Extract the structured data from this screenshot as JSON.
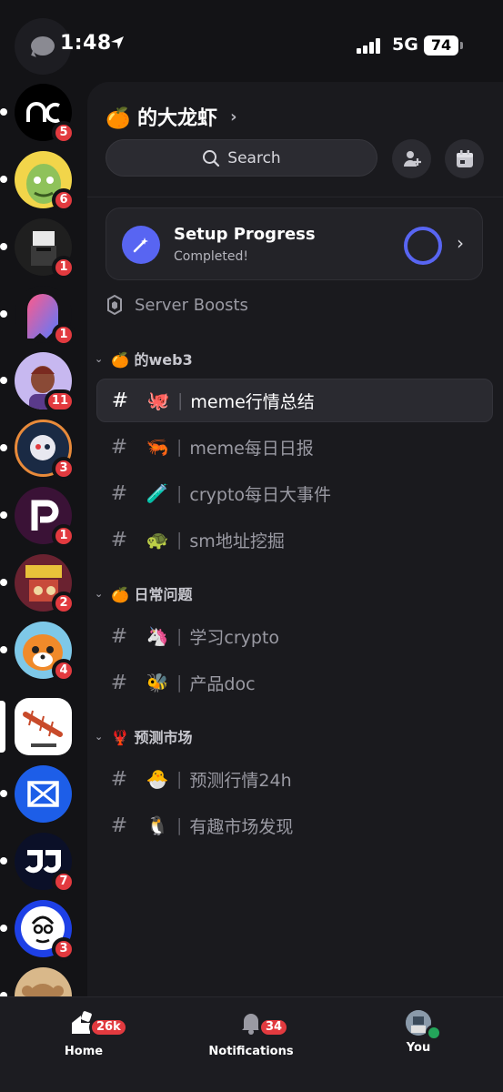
{
  "status": {
    "time": "1:48",
    "network": "5G",
    "battery": "74"
  },
  "rail": {
    "servers": [
      {
        "name": "server-ac",
        "badge": "5",
        "color": "#000000"
      },
      {
        "name": "server-ape",
        "badge": "6",
        "color": "#f2d54a"
      },
      {
        "name": "server-character",
        "badge": "1",
        "color": "#2a2a2a"
      },
      {
        "name": "server-ghost",
        "badge": "1",
        "color": "#131316"
      },
      {
        "name": "server-avatar",
        "badge": "11",
        "color": "#c7b8f0"
      },
      {
        "name": "server-robot",
        "badge": "3",
        "color": "#1a2a44"
      },
      {
        "name": "server-p",
        "badge": "1",
        "color": "#3a1236"
      },
      {
        "name": "server-art",
        "badge": "2",
        "color": "#6a2230"
      },
      {
        "name": "server-tiger",
        "badge": "4",
        "color": "#7ec8e8"
      },
      {
        "name": "server-lobster",
        "badge": "",
        "color": "#ffffff",
        "active": true
      },
      {
        "name": "server-blue",
        "badge": "",
        "color": "#1d5ee8"
      },
      {
        "name": "server-jj",
        "badge": "7",
        "color": "#0b1028"
      },
      {
        "name": "server-sketch",
        "badge": "3",
        "color": "#1e40e6"
      },
      {
        "name": "server-monkey",
        "badge": "",
        "color": "#d9b88a"
      }
    ]
  },
  "server": {
    "title": "🍊 的大龙虾",
    "search_label": "Search",
    "setup_title": "Setup Progress",
    "setup_status": "Completed!",
    "boosts_label": "Server Boosts"
  },
  "categories": [
    {
      "label": "🍊 的web3"
    },
    {
      "label": "🍊 日常问题"
    },
    {
      "label": "🦞 预测市场"
    }
  ],
  "channels": [
    {
      "emoji": "🐙",
      "name": "meme行情总结",
      "selected": true
    },
    {
      "emoji": "🦐",
      "name": "meme每日日报"
    },
    {
      "emoji": "🧪",
      "name": "crypto每日大事件"
    },
    {
      "emoji": "🐢",
      "name": "sm地址挖掘"
    },
    {
      "emoji": "🦄",
      "name": "学习crypto"
    },
    {
      "emoji": "🐝",
      "name": "产品doc"
    },
    {
      "emoji": "🐣",
      "name": "预测行情24h"
    },
    {
      "emoji": "🐧",
      "name": "有趣市场发现"
    }
  ],
  "nav": {
    "home_label": "Home",
    "home_count": "26k",
    "notif_label": "Notifications",
    "notif_count": "34",
    "you_label": "You"
  },
  "colors": {
    "accent": "#5865f2",
    "badge": "#e23a3f",
    "online": "#23a55a"
  }
}
